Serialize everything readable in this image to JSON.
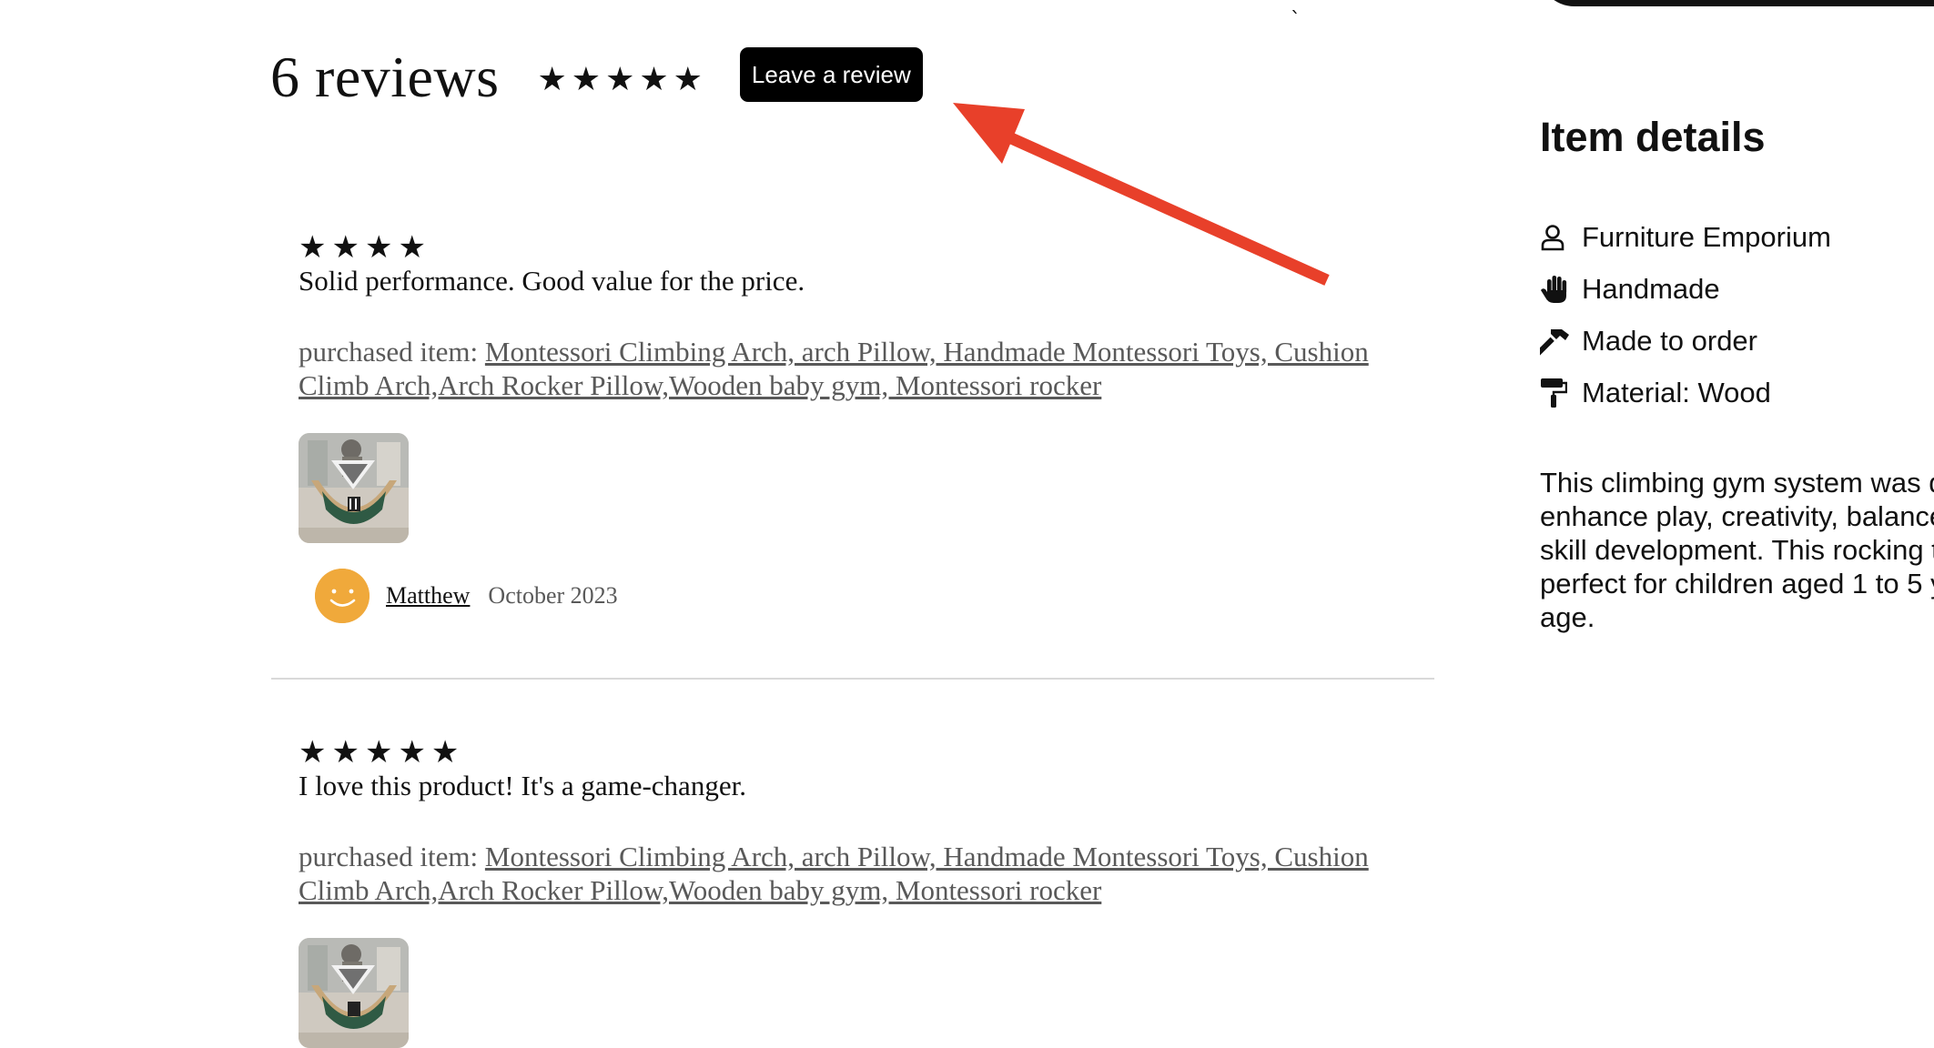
{
  "reviews_header": {
    "title": "6 reviews",
    "stars": "★★★★★",
    "leave_review_label": "Leave a review"
  },
  "reviews": [
    {
      "stars": "★★★★",
      "text": "Solid performance. Good value for the price.",
      "purchased_prefix": "purchased item: ",
      "purchased_item": "Montessori Climbing Arch, arch Pillow, Handmade Montessori Toys, Cushion Climb Arch,Arch Rocker Pillow,Wooden baby gym, Montessori rocker",
      "reviewer": "Matthew",
      "date": "October 2023"
    },
    {
      "stars": "★★★★★",
      "text": "I love this product! It's a game-changer.",
      "purchased_prefix": "purchased item: ",
      "purchased_item": "Montessori Climbing Arch, arch Pillow, Handmade Montessori Toys, Cushion Climb Arch,Arch Rocker Pillow,Wooden baby gym, Montessori rocker"
    }
  ],
  "item_details": {
    "title": "Item details",
    "details": [
      {
        "icon": "user-icon",
        "label": "Furniture Emporium"
      },
      {
        "icon": "hand-icon",
        "label": "Handmade"
      },
      {
        "icon": "hammer-icon",
        "label": "Made to order"
      },
      {
        "icon": "paint-roller-icon",
        "label": "Material: Wood"
      }
    ],
    "description": "This climbing gym system was designed to enhance play, creativity, balance and motor skill development. This rocking triangle is perfect for children aged 1 to 5 years of age."
  },
  "colors": {
    "accent_arrow": "#e8402a",
    "button_bg": "#000000",
    "avatar": "#f0a93b",
    "muted_text": "#595959"
  }
}
